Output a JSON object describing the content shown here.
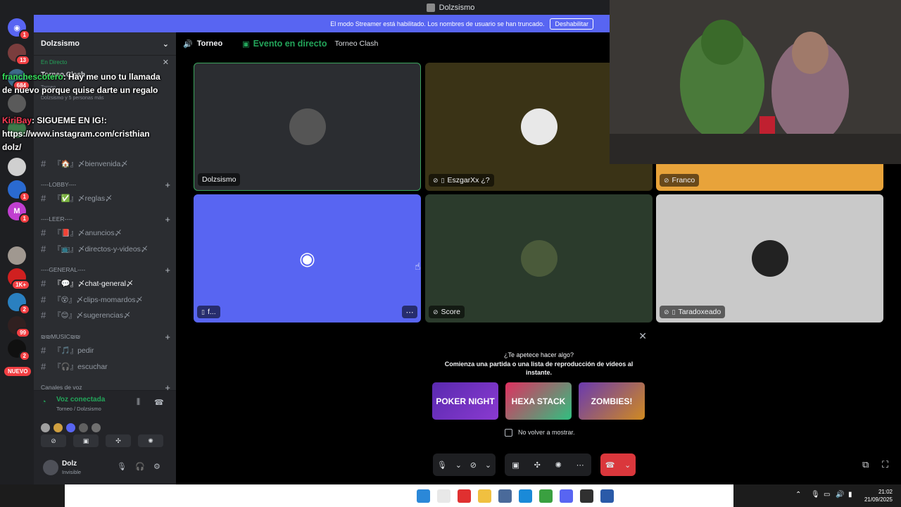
{
  "window": {
    "title": "Dolzsismo"
  },
  "banner": {
    "text": "El modo Streamer está habilitado. Los nombres de usuario se han truncado.",
    "button": "Deshabilitar"
  },
  "rail": {
    "badges": [
      "1",
      "13",
      "684",
      "1",
      "1",
      "1",
      "1K+",
      "2",
      "99",
      "2"
    ],
    "new_label": "NUEVO"
  },
  "server": {
    "name": "Dolzsismo",
    "event": {
      "live": "En Directo",
      "title": "Torneo Clash",
      "subtitle": "Torneo",
      "people": "Dolzsismo y 5 personas más"
    },
    "categories": {
      "lobby": "----LOBBY----",
      "leer": "----LEER----",
      "general": "----GENERAL----",
      "music": "₪₪MUSIC₪₪",
      "voice": "Canales de voz"
    },
    "channels": {
      "bienvenida": "『🏠』〆bienvenida〆",
      "reglas": "『✅』〆reglas〆",
      "anuncios": "『📕』〆anuncios〆",
      "directos": "『📺』〆directos-y-videos〆",
      "chat": "『💬』〆chat-general〆",
      "clips": "『😵』〆clips-momardos〆",
      "sugerencias": "『😊』〆sugerencias〆",
      "pedir": "『🎵』pedir",
      "escuchar": "『🎧』escuchar"
    }
  },
  "voice": {
    "status": "Voz conectada",
    "channel": "Torneo / Dolzsismo"
  },
  "user": {
    "name": "Dolz",
    "status": "Invisible"
  },
  "stage": {
    "voice_channel": "Torneo",
    "event_label": "Evento en directo",
    "event_name": "Torneo Clash"
  },
  "tiles": [
    {
      "name": "Dolzsismo",
      "bg": "#2b2d31",
      "muted": false
    },
    {
      "name": "EszgarXx ¿?",
      "bg": "#3a3316",
      "muted": true
    },
    {
      "name": "Franco",
      "bg": "#e8a33a",
      "muted": true
    },
    {
      "name": "f...",
      "bg": "#5865f2",
      "muted": false
    },
    {
      "name": "Score",
      "bg": "#2b3b2c",
      "muted": true
    },
    {
      "name": "Taradoxeado",
      "bg": "#c9c9c9",
      "muted": true
    }
  ],
  "overlay_chat": [
    {
      "name": "franchescotero",
      "message": ": Hay me uno tu llamada de nuevo porque quise darte un regalo"
    },
    {
      "name": "KiriBay",
      "message": ": SIGUEME EN IG!: https://www.instagram.com/cristhian dolz/"
    }
  ],
  "activity_popup": {
    "question": "¿Te apetece hacer algo?",
    "description": "Comienza una partida o una lista de reproducción de vídeos al instante.",
    "games": [
      "POKER NIGHT",
      "HEXA STACK",
      "ZOMBIES!"
    ],
    "checkbox_label": "No volver a mostrar."
  },
  "taskbar": {
    "time": "21:02",
    "date": "21/09/2025"
  },
  "colors": {
    "accent": "#5865f2",
    "online": "#23a55a",
    "danger": "#da373c"
  }
}
